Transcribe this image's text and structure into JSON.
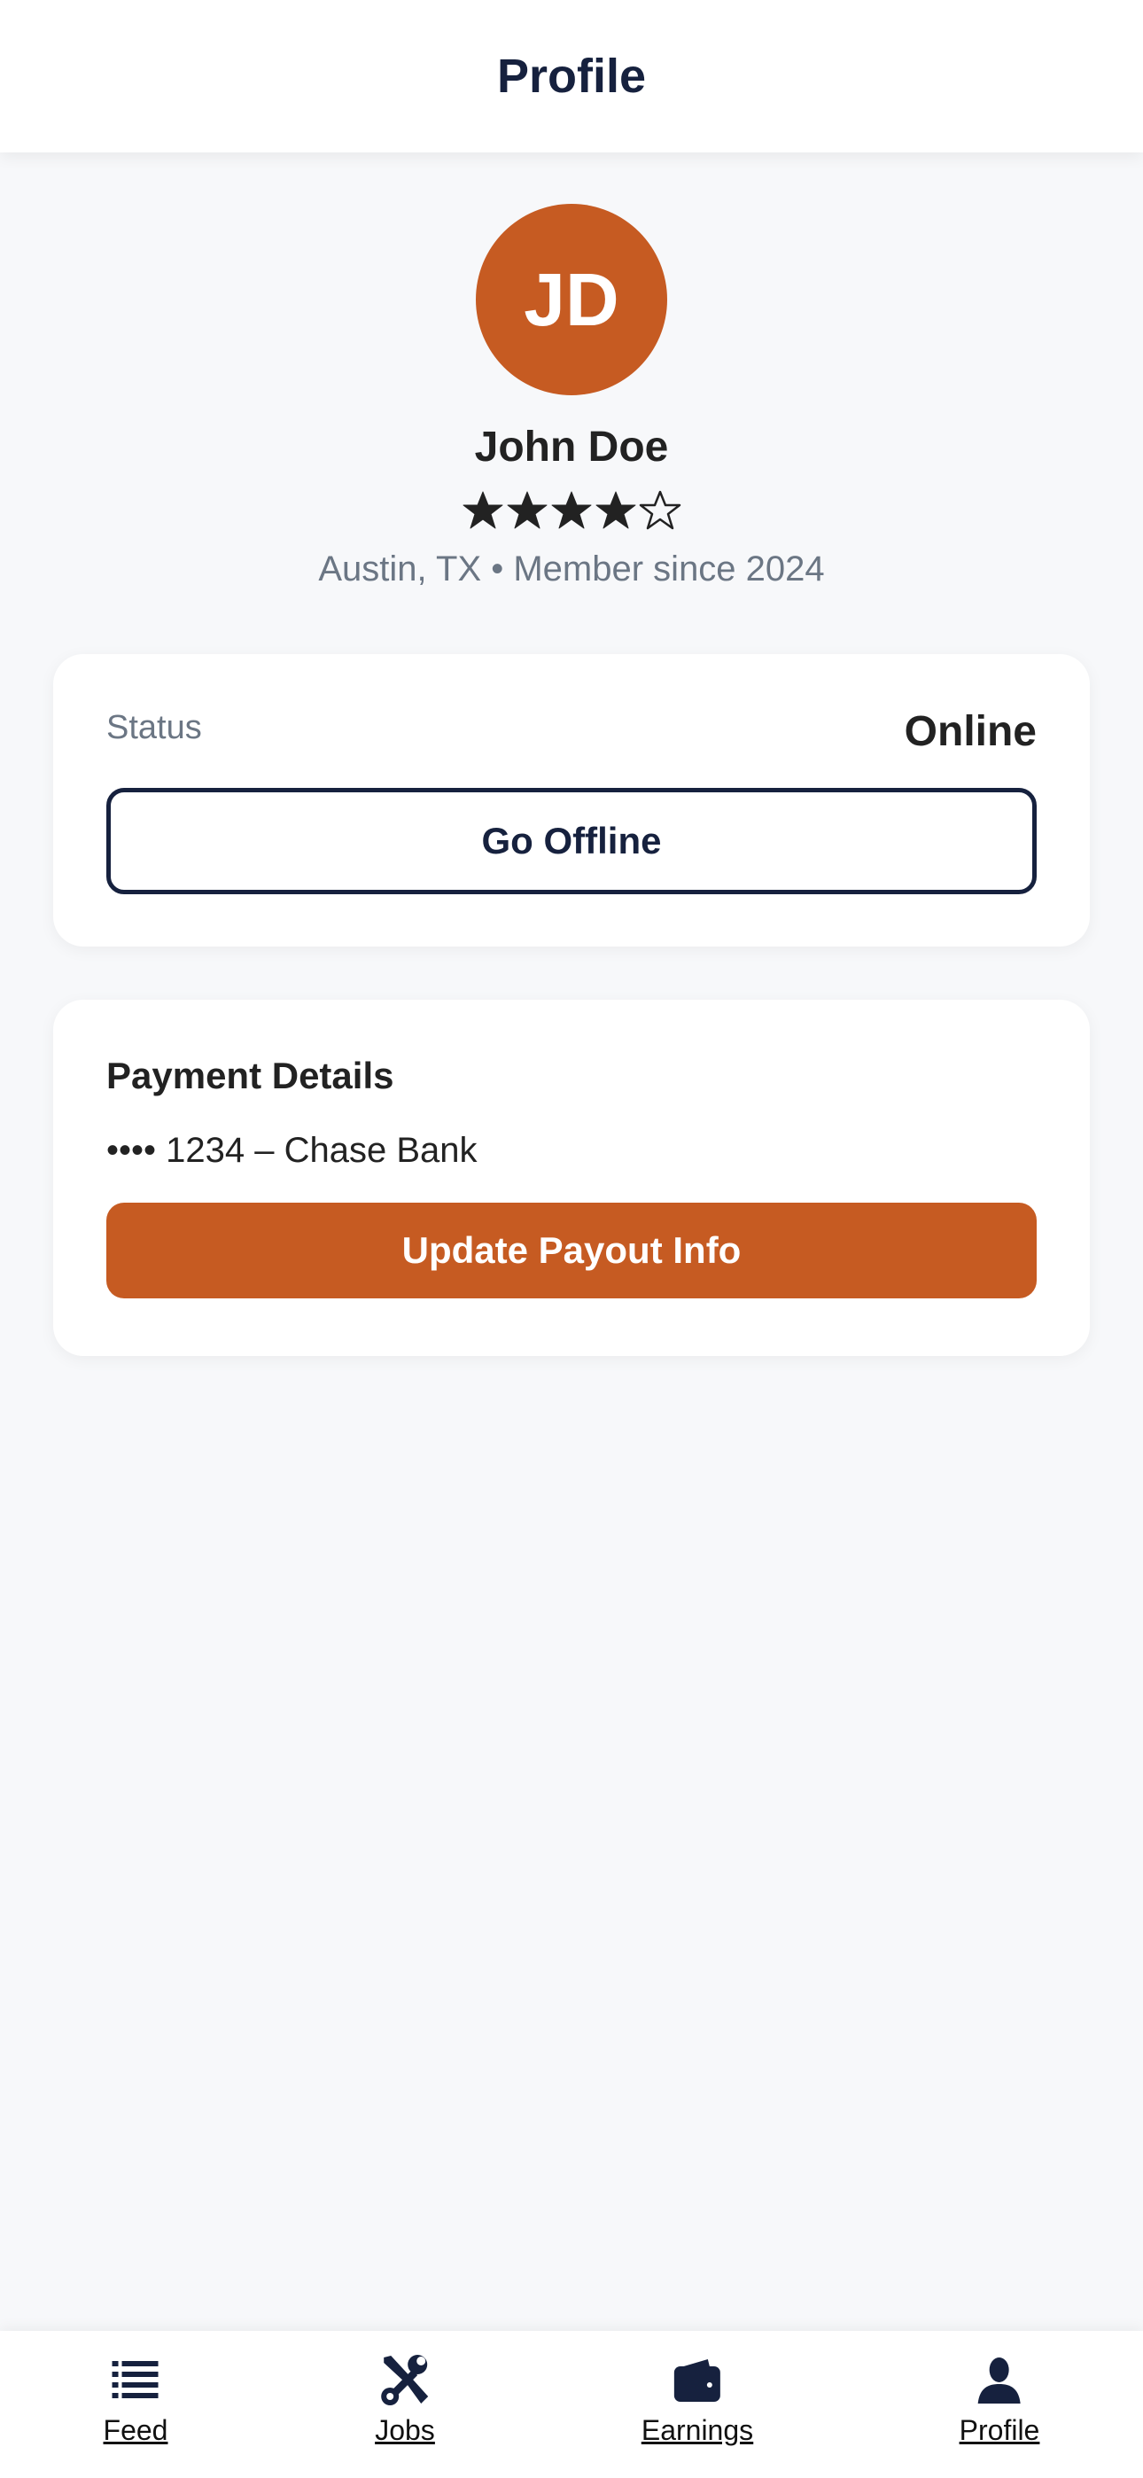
{
  "header": {
    "title": "Profile"
  },
  "profile": {
    "initials": "JD",
    "name": "John Doe",
    "rating": 4,
    "rating_max": 5,
    "location_line": "Austin, TX • Member since 2024"
  },
  "status_card": {
    "label": "Status",
    "value": "Online",
    "button_label": "Go Offline"
  },
  "payment_card": {
    "title": "Payment Details",
    "account": "•••• 1234 – Chase Bank",
    "button_label": "Update Payout Info"
  },
  "tabs": [
    {
      "label": "Feed",
      "icon": "list-icon"
    },
    {
      "label": "Jobs",
      "icon": "tools-icon"
    },
    {
      "label": "Earnings",
      "icon": "wallet-icon"
    },
    {
      "label": "Profile",
      "icon": "user-icon"
    }
  ],
  "colors": {
    "accent": "#c65b22",
    "navy": "#16213e",
    "background": "#f7f8fa",
    "muted_text": "#6b7684"
  }
}
